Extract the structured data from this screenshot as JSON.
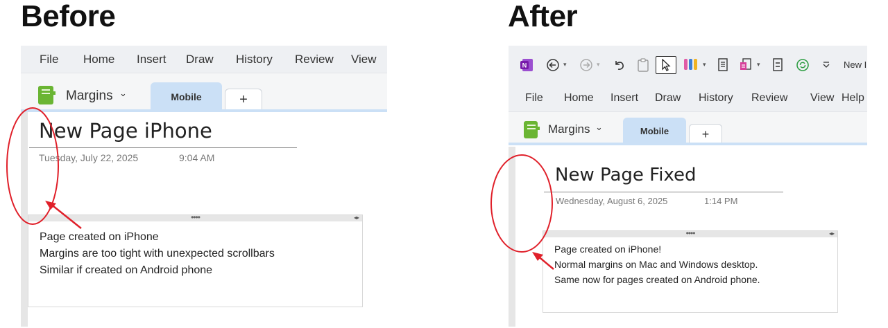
{
  "headings": {
    "before": "Before",
    "after": "After"
  },
  "before": {
    "menu": [
      "File",
      "Home",
      "Insert",
      "Draw",
      "History",
      "Review",
      "View"
    ],
    "notebook": "Margins",
    "section_tab": "Mobile",
    "add_tab": "+",
    "page_title": "New Page iPhone",
    "date": "Tuesday, July 22, 2025",
    "time": "9:04 AM",
    "note_lines": [
      "Page created on iPhone",
      "Margins are too tight with unexpected scrollbars",
      "Similar if created on Android phone"
    ]
  },
  "after": {
    "toolbar": {
      "onenote_icon": "N",
      "back_icon": "back-circle-arrow",
      "forward_icon": "forward-circle-arrow",
      "undo_icon": "undo-arrow",
      "clipboard_icon": "clipboard",
      "select_icon": "cursor-arrow",
      "pens_icon": "pens",
      "page_icon": "page",
      "insert_icon": "insert",
      "layout_icon": "layout",
      "sync_icon": "sync",
      "more_icon": "more-dropdown",
      "overflow_text": "New I"
    },
    "menu": [
      "File",
      "Home",
      "Insert",
      "Draw",
      "History",
      "Review",
      "View",
      "Help"
    ],
    "notebook": "Margins",
    "section_tab": "Mobile",
    "add_tab": "+",
    "page_title": "New Page Fixed",
    "date": "Wednesday, August 6, 2025",
    "time": "1:14 PM",
    "note_lines": [
      "Page created on iPhone!",
      "Normal margins on Mac and Windows desktop.",
      "Same now for pages created on Android phone."
    ]
  },
  "colors": {
    "annotation": "#e0202a",
    "notebook_icon": "#6ab533",
    "section_tab": "#cbe0f6",
    "onenote_brand": "#7719aa",
    "menu_bg": "#eef0f3"
  },
  "glyphs": {
    "grip": "••••",
    "resize_arrows": "◂▸",
    "chevron": "⌄"
  }
}
